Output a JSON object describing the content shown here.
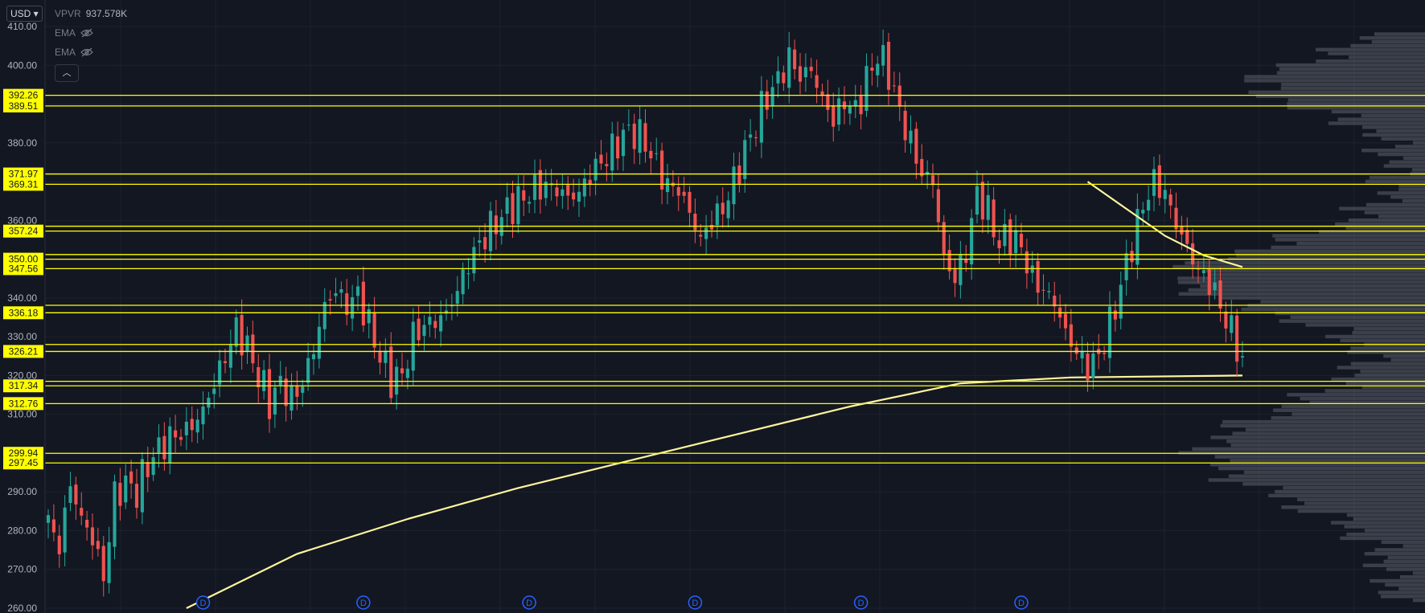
{
  "header": {
    "currency": "USD",
    "indicators": [
      {
        "name": "VPVR",
        "value": "937.578K"
      },
      {
        "name": "EMA",
        "value": ""
      },
      {
        "name": "EMA",
        "value": ""
      }
    ]
  },
  "chart_data": {
    "type": "candlestick",
    "ylim": [
      260,
      410
    ],
    "y_ticks": [
      "260.00",
      "270.00",
      "280.00",
      "290.00",
      "300.00",
      "310.00",
      "320.00",
      "330.00",
      "340.00",
      "350.00",
      "360.00",
      "370.00",
      "380.00",
      "390.00",
      "400.00",
      "410.00"
    ],
    "y_tick_values": [
      260,
      270,
      280,
      290,
      300,
      310,
      320,
      330,
      340,
      350,
      360,
      370,
      380,
      390,
      400,
      410
    ],
    "price_levels": [
      "392.26",
      "389.51",
      "371.97",
      "369.31",
      "357.24",
      "350.00",
      "347.56",
      "336.18",
      "326.21",
      "317.34",
      "312.76",
      "299.94",
      "297.45"
    ],
    "price_level_values": [
      392.26,
      389.51,
      371.97,
      369.31,
      358.5,
      357.24,
      351.2,
      350.0,
      347.56,
      338.1,
      336.18,
      328.0,
      326.21,
      318.5,
      317.34,
      312.76,
      299.94,
      297.45
    ],
    "price_path": [
      [
        0,
        282
      ],
      [
        2,
        276
      ],
      [
        4,
        292
      ],
      [
        6,
        283
      ],
      [
        8,
        278
      ],
      [
        10,
        268
      ],
      [
        12,
        289
      ],
      [
        14,
        292
      ],
      [
        16,
        290
      ],
      [
        18,
        297
      ],
      [
        20,
        301
      ],
      [
        22,
        304
      ],
      [
        24,
        305
      ],
      [
        26,
        307
      ],
      [
        28,
        311
      ],
      [
        30,
        318
      ],
      [
        32,
        325
      ],
      [
        34,
        332
      ],
      [
        36,
        327
      ],
      [
        38,
        320
      ],
      [
        40,
        313
      ],
      [
        42,
        318
      ],
      [
        44,
        314
      ],
      [
        46,
        318
      ],
      [
        48,
        327
      ],
      [
        50,
        338
      ],
      [
        52,
        342
      ],
      [
        54,
        338
      ],
      [
        56,
        341
      ],
      [
        58,
        333
      ],
      [
        60,
        325
      ],
      [
        62,
        319
      ],
      [
        64,
        320
      ],
      [
        66,
        330
      ],
      [
        68,
        333
      ],
      [
        70,
        334
      ],
      [
        72,
        336
      ],
      [
        74,
        342
      ],
      [
        76,
        349
      ],
      [
        78,
        354
      ],
      [
        80,
        358
      ],
      [
        82,
        361
      ],
      [
        84,
        364
      ],
      [
        86,
        366
      ],
      [
        88,
        368
      ],
      [
        90,
        369
      ],
      [
        92,
        368
      ],
      [
        94,
        366
      ],
      [
        96,
        367
      ],
      [
        98,
        372
      ],
      [
        100,
        375
      ],
      [
        102,
        378
      ],
      [
        104,
        382
      ],
      [
        106,
        383
      ],
      [
        108,
        380
      ],
      [
        110,
        374
      ],
      [
        112,
        369
      ],
      [
        114,
        368
      ],
      [
        116,
        362
      ],
      [
        118,
        355
      ],
      [
        120,
        360
      ],
      [
        122,
        363
      ],
      [
        124,
        370
      ],
      [
        126,
        378
      ],
      [
        128,
        385
      ],
      [
        130,
        392
      ],
      [
        132,
        396
      ],
      [
        134,
        402
      ],
      [
        136,
        397
      ],
      [
        138,
        399
      ],
      [
        140,
        391
      ],
      [
        142,
        386
      ],
      [
        144,
        391
      ],
      [
        146,
        388
      ],
      [
        148,
        396
      ],
      [
        150,
        403
      ],
      [
        152,
        398
      ],
      [
        154,
        388
      ],
      [
        156,
        380
      ],
      [
        158,
        372
      ],
      [
        160,
        370
      ],
      [
        162,
        350
      ],
      [
        164,
        345
      ],
      [
        166,
        352
      ],
      [
        168,
        367
      ],
      [
        170,
        362
      ],
      [
        172,
        354
      ],
      [
        174,
        356
      ],
      [
        176,
        353
      ],
      [
        178,
        345
      ],
      [
        180,
        342
      ],
      [
        182,
        339
      ],
      [
        184,
        331
      ],
      [
        186,
        326
      ],
      [
        188,
        322
      ],
      [
        190,
        325
      ],
      [
        192,
        333
      ],
      [
        194,
        343
      ],
      [
        196,
        354
      ],
      [
        198,
        364
      ],
      [
        200,
        370
      ],
      [
        202,
        367
      ],
      [
        204,
        359
      ],
      [
        206,
        353
      ],
      [
        208,
        347
      ],
      [
        210,
        344
      ],
      [
        212,
        338
      ],
      [
        214,
        331
      ],
      [
        216,
        325
      ]
    ],
    "ema_fast": [
      [
        188,
        370
      ],
      [
        195,
        363
      ],
      [
        202,
        356
      ],
      [
        209,
        351
      ],
      [
        216,
        348
      ]
    ],
    "ema_slow": [
      [
        25,
        260
      ],
      [
        45,
        274
      ],
      [
        65,
        283
      ],
      [
        85,
        291
      ],
      [
        105,
        298
      ],
      [
        125,
        305
      ],
      [
        145,
        312
      ],
      [
        165,
        318
      ],
      [
        185,
        319.5
      ],
      [
        216,
        320
      ]
    ],
    "dividend_markers": [
      28,
      57,
      87,
      117,
      147,
      176
    ]
  }
}
